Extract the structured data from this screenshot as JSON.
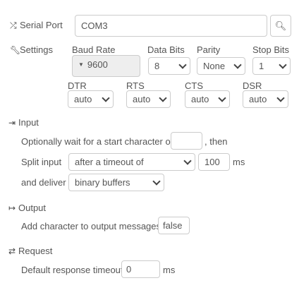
{
  "serial_port": {
    "label": "Serial Port",
    "value": "COM3"
  },
  "settings": {
    "label": "Settings",
    "baud_rate": {
      "label": "Baud Rate",
      "value": "9600"
    },
    "data_bits": {
      "label": "Data Bits",
      "value": "8"
    },
    "parity": {
      "label": "Parity",
      "value": "None"
    },
    "stop_bits": {
      "label": "Stop Bits",
      "value": "1"
    },
    "dtr": {
      "label": "DTR",
      "value": "auto"
    },
    "rts": {
      "label": "RTS",
      "value": "auto"
    },
    "cts": {
      "label": "CTS",
      "value": "auto"
    },
    "dsr": {
      "label": "DSR",
      "value": "auto"
    }
  },
  "input": {
    "header": "Input",
    "wait_text": "Optionally wait for a start character of",
    "wait_value": "",
    "then_text": ", then",
    "split_label": "Split input",
    "split_value": "after a timeout of",
    "split_amount": "100",
    "split_unit": "ms",
    "deliver_label": "and deliver",
    "deliver_value": "binary buffers"
  },
  "output": {
    "header": "Output",
    "add_char_label": "Add character to output messages",
    "add_char_value": "false"
  },
  "request": {
    "header": "Request",
    "timeout_label": "Default response timeout",
    "timeout_value": "0",
    "timeout_unit": "ms"
  }
}
